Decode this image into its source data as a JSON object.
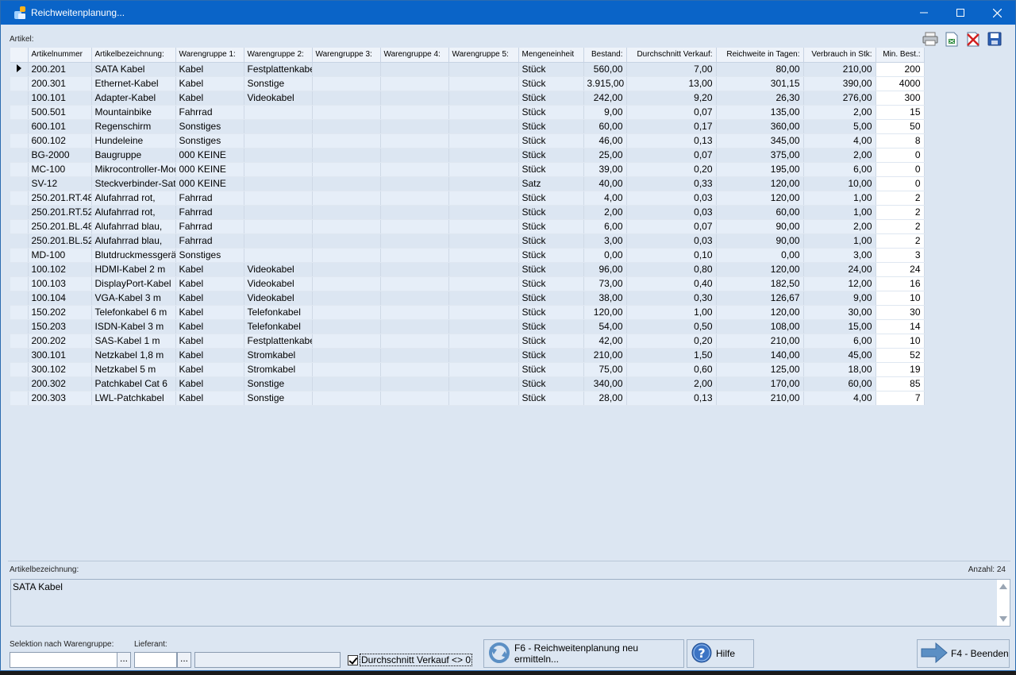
{
  "window": {
    "title": "Reichweitenplanung..."
  },
  "labels": {
    "artikel": "Artikel:",
    "artikelbezeichnung": "Artikelbezeichnung:",
    "anzahl": "Anzahl: 24",
    "selektion": "Selektion nach Warengruppe:",
    "lieferant": "Lieferant:"
  },
  "toolbar": {
    "icons": [
      "printer-icon",
      "excel-export-icon",
      "delete-icon",
      "save-icon"
    ]
  },
  "columns": [
    "Artikelnummer",
    "Artikelbezeichnung:",
    "Warengruppe 1:",
    "Warengruppe 2:",
    "Warengruppe 3:",
    "Warengruppe 4:",
    "Warengruppe 5:",
    "Mengeneinheit",
    "Bestand:",
    "Durchschnitt Verkauf:",
    "Reichweite in Tagen:",
    "Verbrauch in Stk:",
    "Min. Best.:"
  ],
  "rows": [
    [
      "200.201",
      "SATA Kabel",
      "Kabel",
      "Festplattenkabel",
      "",
      "",
      "",
      "Stück",
      "560,00",
      "7,00",
      "80,00",
      "210,00",
      "200"
    ],
    [
      "200.301",
      "Ethernet-Kabel",
      "Kabel",
      "Sonstige",
      "",
      "",
      "",
      "Stück",
      "3.915,00",
      "13,00",
      "301,15",
      "390,00",
      "4000"
    ],
    [
      "100.101",
      "Adapter-Kabel",
      "Kabel",
      "Videokabel",
      "",
      "",
      "",
      "Stück",
      "242,00",
      "9,20",
      "26,30",
      "276,00",
      "300"
    ],
    [
      "500.501",
      "Mountainbike",
      "Fahrrad",
      "",
      "",
      "",
      "",
      "Stück",
      "9,00",
      "0,07",
      "135,00",
      "2,00",
      "15"
    ],
    [
      "600.101",
      "Regenschirm",
      "Sonstiges",
      "",
      "",
      "",
      "",
      "Stück",
      "60,00",
      "0,17",
      "360,00",
      "5,00",
      "50"
    ],
    [
      "600.102",
      "Hundeleine",
      "Sonstiges",
      "",
      "",
      "",
      "",
      "Stück",
      "46,00",
      "0,13",
      "345,00",
      "4,00",
      "8"
    ],
    [
      "BG-2000",
      "Baugruppe",
      "000 KEINE",
      "",
      "",
      "",
      "",
      "Stück",
      "25,00",
      "0,07",
      "375,00",
      "2,00",
      "0"
    ],
    [
      "MC-100",
      "Mikrocontroller-Modul",
      "000 KEINE",
      "",
      "",
      "",
      "",
      "Stück",
      "39,00",
      "0,20",
      "195,00",
      "6,00",
      "0"
    ],
    [
      "SV-12",
      "Steckverbinder-Satz",
      "000 KEINE",
      "",
      "",
      "",
      "",
      "Satz",
      "40,00",
      "0,33",
      "120,00",
      "10,00",
      "0"
    ],
    [
      "250.201.RT.48",
      "Alufahrrad rot,",
      "Fahrrad",
      "",
      "",
      "",
      "",
      "Stück",
      "4,00",
      "0,03",
      "120,00",
      "1,00",
      "2"
    ],
    [
      "250.201.RT.52",
      "Alufahrrad rot,",
      "Fahrrad",
      "",
      "",
      "",
      "",
      "Stück",
      "2,00",
      "0,03",
      "60,00",
      "1,00",
      "2"
    ],
    [
      "250.201.BL.48",
      "Alufahrrad blau,",
      "Fahrrad",
      "",
      "",
      "",
      "",
      "Stück",
      "6,00",
      "0,07",
      "90,00",
      "2,00",
      "2"
    ],
    [
      "250.201.BL.52",
      "Alufahrrad blau,",
      "Fahrrad",
      "",
      "",
      "",
      "",
      "Stück",
      "3,00",
      "0,03",
      "90,00",
      "1,00",
      "2"
    ],
    [
      "MD-100",
      "Blutdruckmessgerät",
      "Sonstiges",
      "",
      "",
      "",
      "",
      "Stück",
      "0,00",
      "0,10",
      "0,00",
      "3,00",
      "3"
    ],
    [
      "100.102",
      "HDMI-Kabel 2 m",
      "Kabel",
      "Videokabel",
      "",
      "",
      "",
      "Stück",
      "96,00",
      "0,80",
      "120,00",
      "24,00",
      "24"
    ],
    [
      "100.103",
      "DisplayPort-Kabel",
      "Kabel",
      "Videokabel",
      "",
      "",
      "",
      "Stück",
      "73,00",
      "0,40",
      "182,50",
      "12,00",
      "16"
    ],
    [
      "100.104",
      "VGA-Kabel 3 m",
      "Kabel",
      "Videokabel",
      "",
      "",
      "",
      "Stück",
      "38,00",
      "0,30",
      "126,67",
      "9,00",
      "10"
    ],
    [
      "150.202",
      "Telefonkabel 6 m",
      "Kabel",
      "Telefonkabel",
      "",
      "",
      "",
      "Stück",
      "120,00",
      "1,00",
      "120,00",
      "30,00",
      "30"
    ],
    [
      "150.203",
      "ISDN-Kabel 3 m",
      "Kabel",
      "Telefonkabel",
      "",
      "",
      "",
      "Stück",
      "54,00",
      "0,50",
      "108,00",
      "15,00",
      "14"
    ],
    [
      "200.202",
      "SAS-Kabel 1 m",
      "Kabel",
      "Festplattenkabel",
      "",
      "",
      "",
      "Stück",
      "42,00",
      "0,20",
      "210,00",
      "6,00",
      "10"
    ],
    [
      "300.101",
      "Netzkabel 1,8 m",
      "Kabel",
      "Stromkabel",
      "",
      "",
      "",
      "Stück",
      "210,00",
      "1,50",
      "140,00",
      "45,00",
      "52"
    ],
    [
      "300.102",
      "Netzkabel 5 m",
      "Kabel",
      "Stromkabel",
      "",
      "",
      "",
      "Stück",
      "75,00",
      "0,60",
      "125,00",
      "18,00",
      "19"
    ],
    [
      "200.302",
      "Patchkabel Cat 6",
      "Kabel",
      "Sonstige",
      "",
      "",
      "",
      "Stück",
      "340,00",
      "2,00",
      "170,00",
      "60,00",
      "85"
    ],
    [
      "200.303",
      "LWL-Patchkabel",
      "Kabel",
      "Sonstige",
      "",
      "",
      "",
      "Stück",
      "28,00",
      "0,13",
      "210,00",
      "4,00",
      "7"
    ]
  ],
  "memo": {
    "text": "SATA Kabel"
  },
  "filter": {
    "warengruppe_value": "",
    "lieferant_value": "",
    "lieferant_name": "",
    "dots": "..."
  },
  "checkbox": {
    "label": "Durchschnitt Verkauf <> 0",
    "checked": true
  },
  "buttons": {
    "f6_line1": "F6 - Reichweitenplanung neu",
    "f6_line2": "ermitteln...",
    "hilfe": "Hilfe",
    "beenden": "F4 - Beenden"
  },
  "colors": {
    "titlebar": "#0a64c8",
    "background": "#dce6f2",
    "accent_arrow": "#5b8fc4"
  }
}
